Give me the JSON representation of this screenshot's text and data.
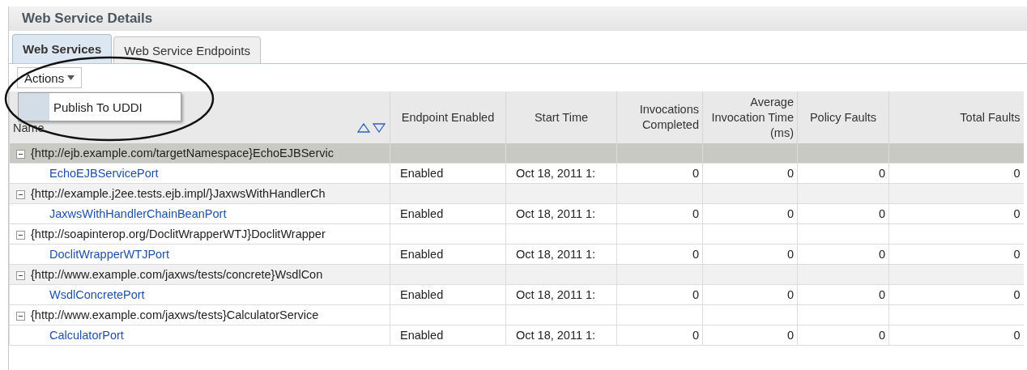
{
  "panel": {
    "title": "Web Service Details"
  },
  "tabs": [
    {
      "label": "Web Services",
      "selected": true
    },
    {
      "label": "Web Service Endpoints",
      "selected": false
    }
  ],
  "actions": {
    "label": "Actions",
    "menu": [
      "Publish To UDDI"
    ]
  },
  "table": {
    "columns": [
      {
        "label": "Name"
      },
      {
        "label": "Endpoint Enabled"
      },
      {
        "label": "Start Time"
      },
      {
        "label": "Invocations Completed"
      },
      {
        "label": "Average Invocation Time (ms)"
      },
      {
        "label": "Policy Faults"
      },
      {
        "label": "Total Faults"
      }
    ],
    "groups": [
      {
        "name": "{http://ejb.example.com/targetNamespace}EchoEJBServic",
        "expanded": true,
        "selected": true,
        "children": [
          {
            "name": "EchoEJBServicePort",
            "cells": [
              "Enabled",
              "Oct 18, 2011 1:",
              "0",
              "0",
              "0",
              "0"
            ]
          }
        ]
      },
      {
        "name": "{http://example.j2ee.tests.ejb.impl/}JaxwsWithHandlerCh",
        "expanded": true,
        "selected": false,
        "children": [
          {
            "name": "JaxwsWithHandlerChainBeanPort",
            "cells": [
              "Enabled",
              "Oct 18, 2011 1:",
              "0",
              "0",
              "0",
              "0"
            ]
          }
        ]
      },
      {
        "name": "{http://soapinterop.org/DoclitWrapperWTJ}DoclitWrapper",
        "expanded": true,
        "selected": false,
        "children": [
          {
            "name": "DoclitWrapperWTJPort",
            "cells": [
              "Enabled",
              "Oct 18, 2011 1:",
              "0",
              "0",
              "0",
              "0"
            ]
          }
        ]
      },
      {
        "name": "{http://www.example.com/jaxws/tests/concrete}WsdlCon",
        "expanded": true,
        "selected": false,
        "children": [
          {
            "name": "WsdlConcretePort",
            "cells": [
              "Enabled",
              "Oct 18, 2011 1:",
              "0",
              "0",
              "0",
              "0"
            ]
          }
        ]
      },
      {
        "name": "{http://www.example.com/jaxws/tests}CalculatorService",
        "expanded": true,
        "selected": false,
        "children": [
          {
            "name": "CalculatorPort",
            "cells": [
              "Enabled",
              "Oct 18, 2011 1:",
              "0",
              "0",
              "0",
              "0"
            ]
          }
        ]
      }
    ]
  }
}
